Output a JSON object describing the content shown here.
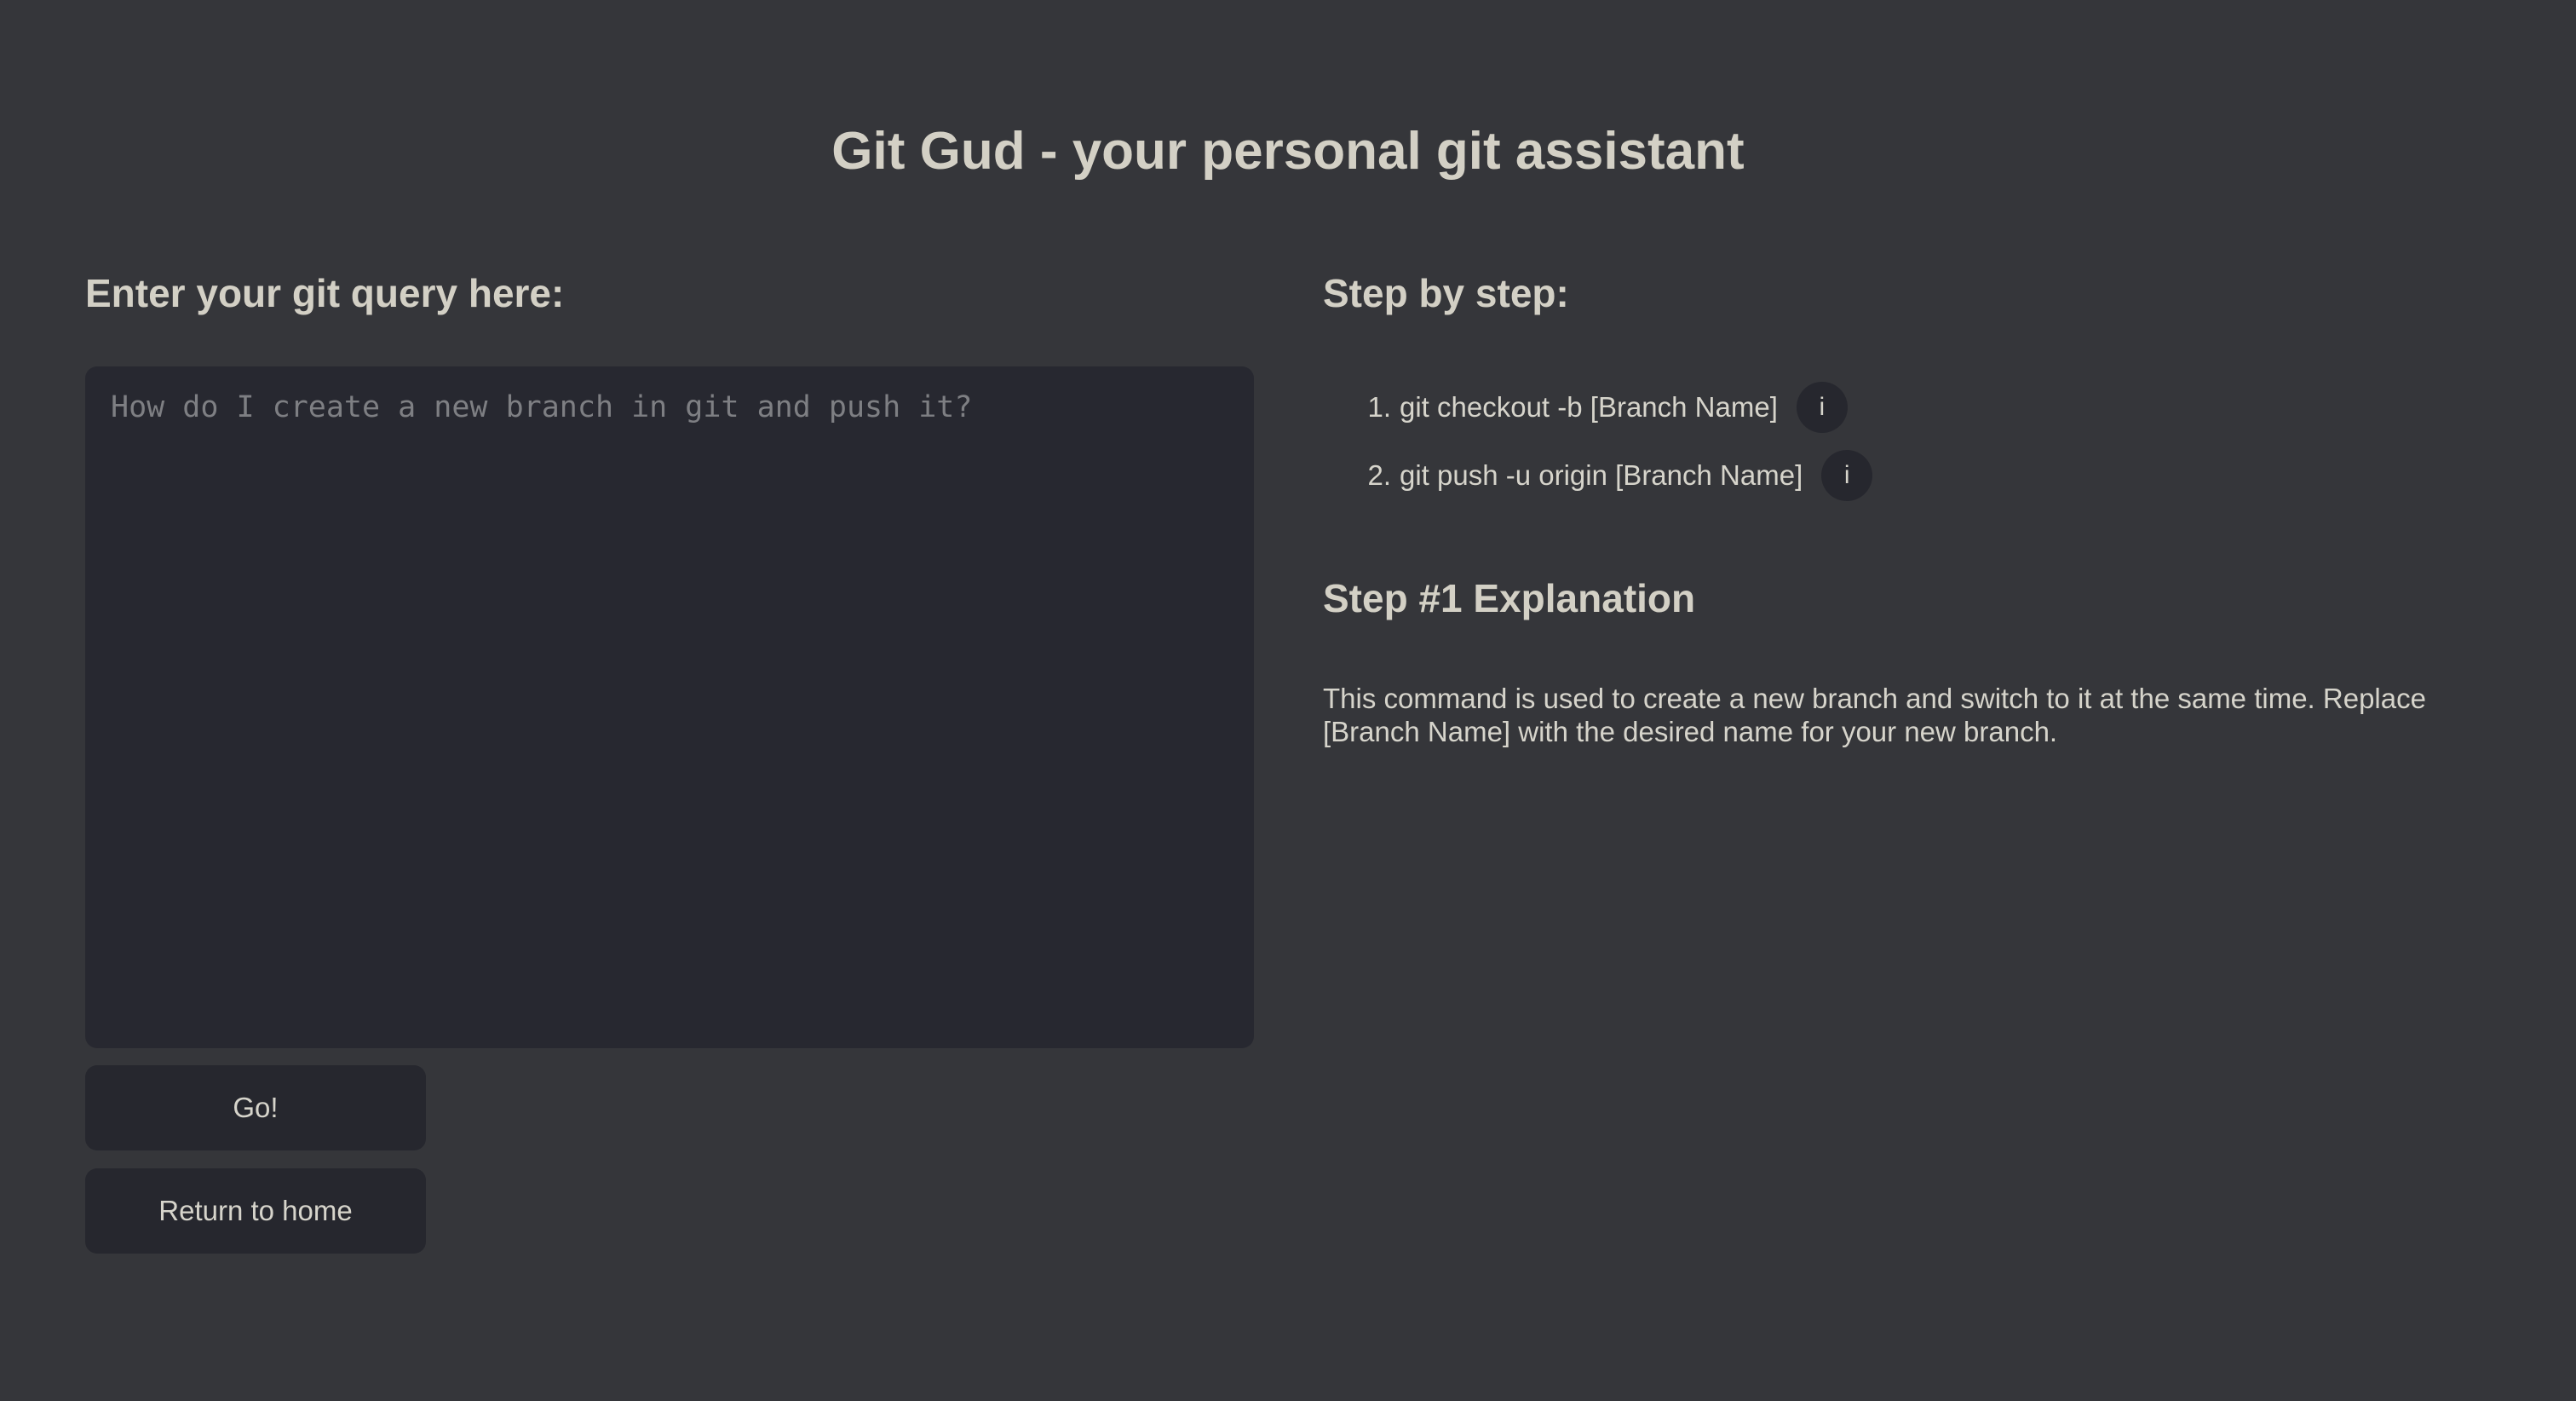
{
  "header": {
    "title": "Git Gud - your personal git assistant"
  },
  "query": {
    "heading": "Enter your git query here:",
    "value": "",
    "placeholder": "How do I create a new branch in git and push it?",
    "go_label": "Go!",
    "home_label": "Return to home"
  },
  "steps": {
    "heading": "Step by step:",
    "items": [
      {
        "number": "1.",
        "command": "git checkout -b [Branch Name]",
        "info_label": "i"
      },
      {
        "number": "2.",
        "command": "git push -u origin [Branch Name]",
        "info_label": "i"
      }
    ]
  },
  "explanation": {
    "heading": "Step #1 Explanation",
    "text": "This command is used to create a new branch and switch to it at the same time. Replace [Branch Name] with the desired name for your new branch."
  },
  "colors": {
    "background": "#35363a",
    "panel": "#272830",
    "button": "#26272e",
    "text": "#d6d4cb",
    "placeholder": "#7e7f83"
  }
}
